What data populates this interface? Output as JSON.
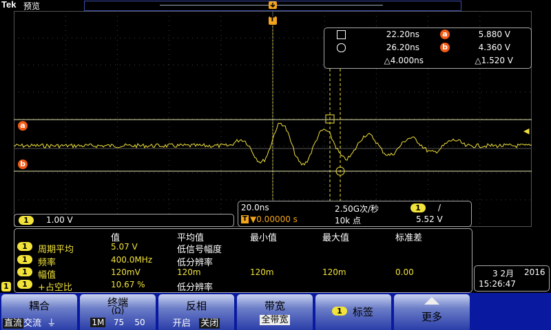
{
  "header": {
    "logo": "Tek",
    "mode": "预览"
  },
  "trigger": {
    "marker": "T"
  },
  "cursors": {
    "label_a": "a",
    "label_b": "b",
    "t1": "22.20ns",
    "t2": "26.20ns",
    "dt": "△4.000ns",
    "va": "5.880 V",
    "vb": "4.360 V",
    "dv": "△1.520 V"
  },
  "channel": {
    "num": "1",
    "scale": "1.00 V"
  },
  "timebase": {
    "scale": "20.0ns",
    "sample_rate": "2.50G次/秒",
    "trigger_pos": "▼0.00000 s",
    "record": "10k 点",
    "trig_level": "5.52 V",
    "trig_ch": "1",
    "trig_slope": "/"
  },
  "measurements": {
    "headers": [
      "值",
      "平均值",
      "最小值",
      "最大值",
      "标准差"
    ],
    "rows": [
      {
        "ch": "1",
        "name": "周期平均",
        "value": "5.07 V",
        "mean": "低信号幅度",
        "min": "",
        "max": "",
        "std": ""
      },
      {
        "ch": "1",
        "name": "频率",
        "value": "400.0MHz",
        "mean": "低分辨率",
        "min": "",
        "max": "",
        "std": ""
      },
      {
        "ch": "1",
        "name": "幅值",
        "value": "120mV",
        "mean": "120m",
        "min": "120m",
        "max": "120m",
        "std": "0.00"
      },
      {
        "ch": "1",
        "name": "+占空比",
        "value": "10.67 %",
        "mean": "低分辨率",
        "min": "",
        "max": "",
        "std": ""
      }
    ],
    "side_badge": "1"
  },
  "datetime": {
    "date": "3 2月",
    "year": "2016",
    "time": "15:26:47"
  },
  "menu": {
    "coupling": {
      "title": "耦合",
      "opts": [
        "直流",
        "交流",
        "⏚"
      ]
    },
    "termination": {
      "title": "终端",
      "sub": "(Ω)",
      "opts": [
        "1M",
        "75",
        "50"
      ]
    },
    "invert": {
      "title": "反相",
      "opts": [
        "开启",
        "关闭"
      ]
    },
    "bandwidth": {
      "title": "带宽",
      "value": "全带宽"
    },
    "label": {
      "ch": "1",
      "title": "标签"
    },
    "more": {
      "title": "更多"
    }
  },
  "colors": {
    "trace": "#f2e33a",
    "cursor_marker": "#f25a14",
    "menu_bg": "#0a1aa0"
  }
}
